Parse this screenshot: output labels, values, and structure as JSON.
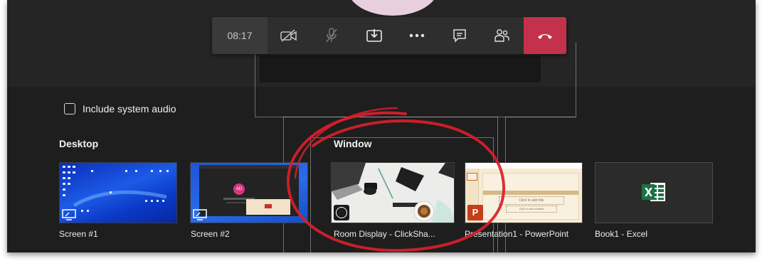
{
  "toolbar": {
    "timer": "08:17",
    "buttons": [
      {
        "name": "camera-off-icon"
      },
      {
        "name": "microphone-off-icon"
      },
      {
        "name": "share-tray-icon"
      },
      {
        "name": "more-options-icon"
      },
      {
        "name": "chat-icon"
      },
      {
        "name": "participants-icon"
      },
      {
        "name": "hang-up-icon"
      }
    ],
    "end_call_color": "#c4314b"
  },
  "share": {
    "include_audio_label": "Include system audio",
    "include_audio_checked": false,
    "desktop_label": "Desktop",
    "window_label": "Window",
    "screens": [
      {
        "label": "Screen #1"
      },
      {
        "label": "Screen #2"
      }
    ],
    "windows": [
      {
        "label": "Room Display - ClickSha...",
        "app_icon": "clickshare-icon"
      },
      {
        "label": "Presentation1 - PowerPoint",
        "app_icon": "powerpoint-icon",
        "slide_title": "Click to add title",
        "slide_subtitle": "Click to add subtitle"
      },
      {
        "label": "Book1 - Excel",
        "app_icon": "excel-icon"
      }
    ]
  },
  "annotation": {
    "color": "#d8202b",
    "shape": "hand-drawn circle around Room Display window"
  }
}
